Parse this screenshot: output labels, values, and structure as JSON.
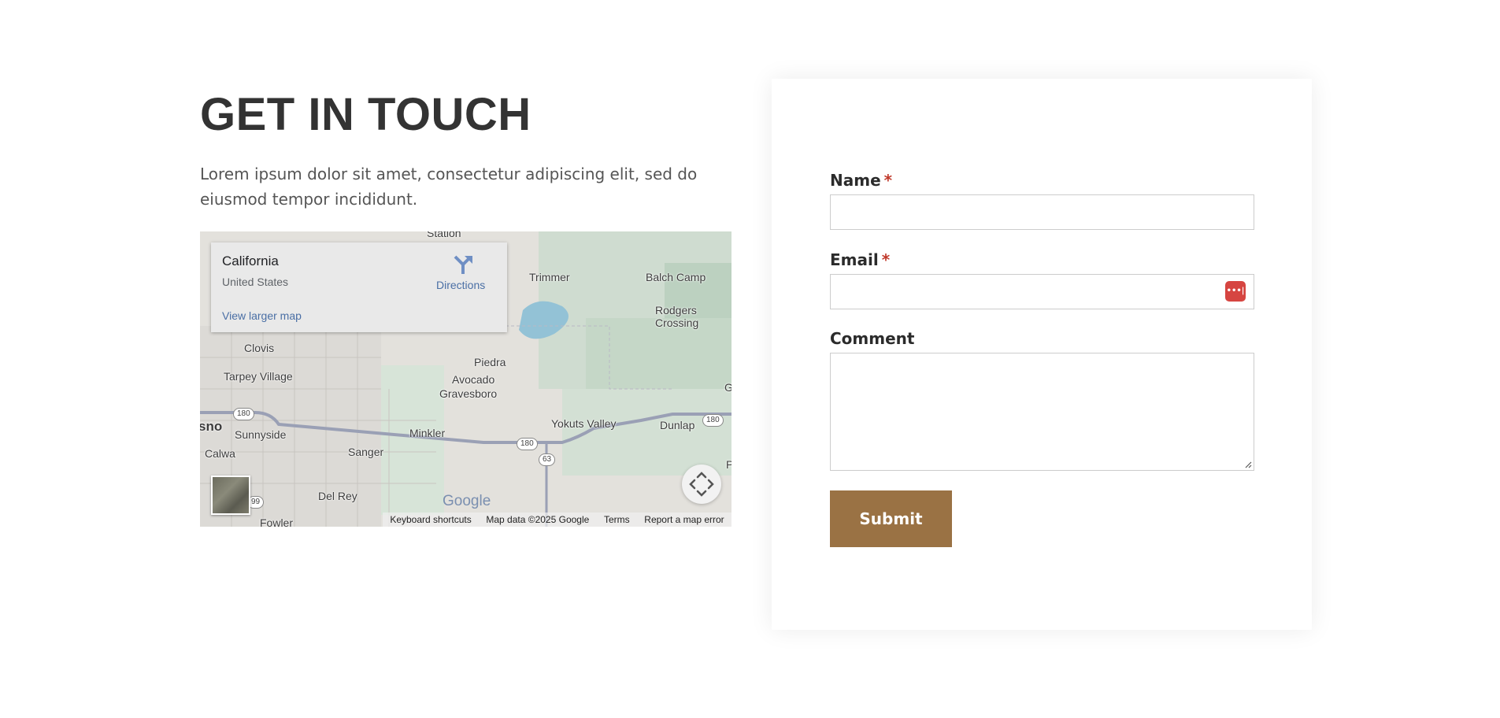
{
  "contact": {
    "heading": "GET IN TOUCH",
    "intro": "Lorem ipsum dolor sit amet, consectetur adipiscing elit, sed do eiusmod tempor incididunt."
  },
  "map": {
    "info": {
      "title": "California",
      "subtitle": "United States",
      "directions": "Directions",
      "view_larger": "View larger map"
    },
    "labels": {
      "station": "Station",
      "trimmer": "Trimmer",
      "balch_camp": "Balch Camp",
      "rodgers": "Rodgers",
      "crossing": "Crossing",
      "clovis": "Clovis",
      "tarpey": "Tarpey Village",
      "piedra": "Piedra",
      "avocado": "Avocado",
      "gravesboro": "Gravesboro",
      "sno": "sno",
      "sunnyside": "Sunnyside",
      "minkler": "Minkler",
      "yokuts": "Yokuts Valley",
      "dunlap": "Dunlap",
      "calwa": "Calwa",
      "sanger": "Sanger",
      "del_rey": "Del Rey",
      "fowler": "Fowler",
      "g_edge": "G",
      "p_edge": "P"
    },
    "highways": {
      "h180_a": "180",
      "h180_b": "180",
      "h180_c": "180",
      "h63": "63",
      "h99": "99"
    },
    "google": "Google",
    "attribution": {
      "shortcuts": "Keyboard shortcuts",
      "data": "Map data ©2025 Google",
      "terms": "Terms",
      "report": "Report a map error"
    }
  },
  "form": {
    "name_label": "Name",
    "email_label": "Email",
    "comment_label": "Comment",
    "required_mark": "*",
    "name_value": "",
    "email_value": "",
    "comment_value": "",
    "submit": "Submit",
    "password_manager_icon": "•••|"
  },
  "colors": {
    "accent": "#9a7244",
    "required": "#c0392b"
  }
}
